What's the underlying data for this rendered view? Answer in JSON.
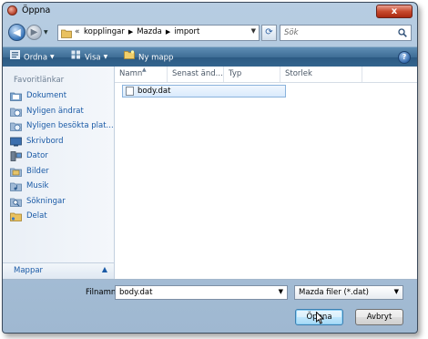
{
  "window": {
    "title": "Öppna",
    "close_label": "x"
  },
  "nav": {
    "back_glyph": "◀",
    "forward_glyph": "▶",
    "breadcrumbs": [
      "kopplingar",
      "Mazda",
      "import"
    ],
    "search_placeholder": "Sök"
  },
  "toolbar": {
    "organize_label": "Ordna",
    "view_label": "Visa",
    "new_folder_label": "Ny mapp",
    "help_label": "?"
  },
  "sidebar": {
    "header": "Favoritlänkar",
    "items": [
      {
        "label": "Dokument",
        "icon": "documents-icon"
      },
      {
        "label": "Nyligen ändrat",
        "icon": "recently-changed-icon"
      },
      {
        "label": "Nyligen besökta plat...",
        "icon": "recent-places-icon"
      },
      {
        "label": "Skrivbord",
        "icon": "desktop-icon"
      },
      {
        "label": "Dator",
        "icon": "computer-icon"
      },
      {
        "label": "Bilder",
        "icon": "pictures-icon"
      },
      {
        "label": "Musik",
        "icon": "music-icon"
      },
      {
        "label": "Sökningar",
        "icon": "searches-icon"
      },
      {
        "label": "Delat",
        "icon": "shared-folder-icon"
      }
    ],
    "folders_label": "Mappar"
  },
  "file_list": {
    "columns": [
      "Namn",
      "Senast änd...",
      "Typ",
      "Storlek"
    ],
    "files": [
      {
        "name": "body.dat"
      }
    ]
  },
  "footer": {
    "filename_label": "Filnamn:",
    "filename_value": "body.dat",
    "filetype_value": "Mazda filer (*.dat)",
    "open_label": "Öppna",
    "cancel_label": "Avbryt"
  },
  "colors": {
    "toolbar_top": "#5f8db4",
    "toolbar_bottom": "#2c5a83",
    "link_blue": "#1a5aa6",
    "selection_border": "#8ab3dc",
    "close_red": "#c84a2e"
  }
}
